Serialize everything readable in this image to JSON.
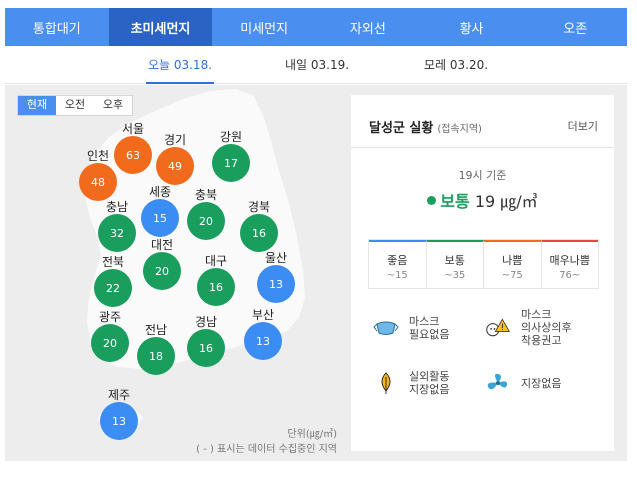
{
  "top_tabs": [
    "통합대기",
    "초미세먼지",
    "미세먼지",
    "자외선",
    "황사",
    "오존"
  ],
  "date_tabs": [
    "오늘 03.18.",
    "내일 03.19.",
    "모레 03.20."
  ],
  "time_toggle": [
    "현재",
    "오전",
    "오후"
  ],
  "regions": [
    {
      "name": "서울",
      "value": "63",
      "level": "bad"
    },
    {
      "name": "경기",
      "value": "49",
      "level": "bad"
    },
    {
      "name": "강원",
      "value": "17",
      "level": "normal"
    },
    {
      "name": "인천",
      "value": "48",
      "level": "bad"
    },
    {
      "name": "세종",
      "value": "15",
      "level": "good"
    },
    {
      "name": "충북",
      "value": "20",
      "level": "normal"
    },
    {
      "name": "충남",
      "value": "32",
      "level": "normal"
    },
    {
      "name": "경북",
      "value": "16",
      "level": "normal"
    },
    {
      "name": "대전",
      "value": "20",
      "level": "normal"
    },
    {
      "name": "전북",
      "value": "22",
      "level": "normal"
    },
    {
      "name": "대구",
      "value": "16",
      "level": "normal"
    },
    {
      "name": "울산",
      "value": "13",
      "level": "good"
    },
    {
      "name": "광주",
      "value": "20",
      "level": "normal"
    },
    {
      "name": "전남",
      "value": "18",
      "level": "normal"
    },
    {
      "name": "경남",
      "value": "16",
      "level": "normal"
    },
    {
      "name": "부산",
      "value": "13",
      "level": "good"
    },
    {
      "name": "제주",
      "value": "13",
      "level": "good"
    }
  ],
  "unit_note": "단위(㎍/㎥)",
  "missing_note": "( - ) 표시는 데이터 수집중인 지역",
  "info": {
    "title": "달성군 실황",
    "subtitle": "(접속지역)",
    "more": "더보기",
    "time_basis": "19시 기준",
    "status_label": "보통",
    "status_value": "19 ㎍/㎥",
    "status_color": "#1a9e5d"
  },
  "levels": [
    {
      "name": "좋음",
      "range": "~15"
    },
    {
      "name": "보통",
      "range": "~35"
    },
    {
      "name": "나쁨",
      "range": "~75"
    },
    {
      "name": "매우나쁨",
      "range": "76~"
    }
  ],
  "advice": {
    "mask": "마스크\n필요없음",
    "sensitive": "마스크\n의사상의후\n착용권고",
    "outdoor": "실외활동\n지장없음",
    "ventilation": "지장없음"
  },
  "colors": {
    "good": "#3b8df3",
    "normal": "#1a9e5d",
    "bad": "#f26a1c",
    "very_bad": "#e84545",
    "accent": "#4a8ff0"
  }
}
